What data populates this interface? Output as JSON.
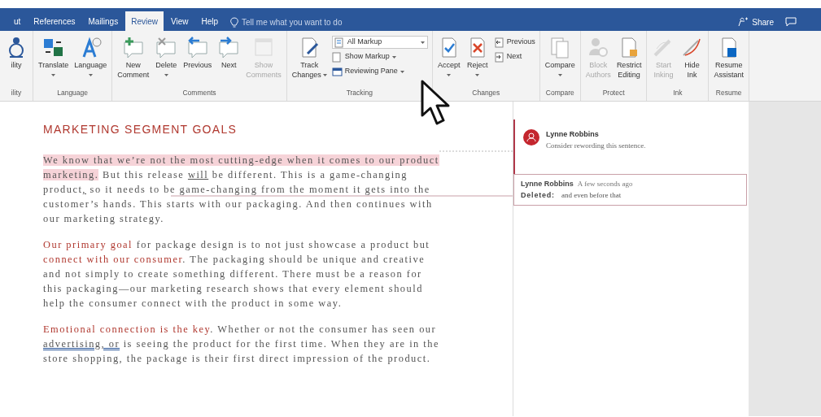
{
  "tabs": [
    {
      "label": "ut",
      "selected": false
    },
    {
      "label": "References",
      "selected": false
    },
    {
      "label": "Mailings",
      "selected": false
    },
    {
      "label": "Review",
      "selected": true
    },
    {
      "label": "View",
      "selected": false
    },
    {
      "label": "Help",
      "selected": false
    }
  ],
  "tell_me": {
    "placeholder": "Tell me what you want to do"
  },
  "share": {
    "label": "Share"
  },
  "ribbon": {
    "groups": [
      {
        "label": "ility",
        "items": [
          {
            "kind": "large",
            "lines": [
              "ility"
            ],
            "disabled": false,
            "dropdown": false
          }
        ]
      },
      {
        "label": "Language",
        "items": [
          {
            "kind": "large",
            "lines": [
              "Translate"
            ],
            "disabled": false,
            "dropdown": true
          },
          {
            "kind": "large",
            "lines": [
              "Language"
            ],
            "disabled": false,
            "dropdown": true
          }
        ]
      },
      {
        "label": "Comments",
        "items": [
          {
            "kind": "large",
            "lines": [
              "New",
              "Comment"
            ],
            "disabled": false,
            "dropdown": false
          },
          {
            "kind": "large",
            "lines": [
              "Delete"
            ],
            "disabled": false,
            "dropdown": true
          },
          {
            "kind": "large",
            "lines": [
              "Previous"
            ],
            "disabled": false,
            "dropdown": false
          },
          {
            "kind": "large",
            "lines": [
              "Next"
            ],
            "disabled": false,
            "dropdown": false
          },
          {
            "kind": "large",
            "lines": [
              "Show",
              "Comments"
            ],
            "disabled": true,
            "dropdown": false
          }
        ]
      },
      {
        "label": "Tracking",
        "items": [
          {
            "kind": "large",
            "lines": [
              "Track",
              "Changes"
            ],
            "disabled": false,
            "dropdown": true
          },
          {
            "kind": "stack",
            "items": [
              {
                "kind": "combo",
                "label": "All Markup",
                "dropdown": true
              },
              {
                "kind": "small",
                "label": "Show Markup",
                "dropdown": true
              },
              {
                "kind": "small",
                "label": "Reviewing Pane",
                "dropdown": true
              }
            ]
          }
        ]
      },
      {
        "label": "Changes",
        "items": [
          {
            "kind": "large",
            "lines": [
              "Accept"
            ],
            "disabled": false,
            "dropdown": true
          },
          {
            "kind": "large",
            "lines": [
              "Reject"
            ],
            "disabled": false,
            "dropdown": true
          },
          {
            "kind": "stack",
            "items": [
              {
                "kind": "small",
                "label": "Previous",
                "dropdown": false
              },
              {
                "kind": "small",
                "label": "Next",
                "dropdown": false
              }
            ]
          }
        ]
      },
      {
        "label": "Compare",
        "items": [
          {
            "kind": "large",
            "lines": [
              "Compare"
            ],
            "disabled": false,
            "dropdown": true
          }
        ]
      },
      {
        "label": "Protect",
        "items": [
          {
            "kind": "large",
            "lines": [
              "Block",
              "Authors"
            ],
            "disabled": true,
            "dropdown": false
          },
          {
            "kind": "large",
            "lines": [
              "Restrict",
              "Editing"
            ],
            "disabled": false,
            "dropdown": false
          }
        ]
      },
      {
        "label": "Ink",
        "items": [
          {
            "kind": "large",
            "lines": [
              "Start",
              "Inking"
            ],
            "disabled": true,
            "dropdown": false
          },
          {
            "kind": "large",
            "lines": [
              "Hide",
              "Ink"
            ],
            "disabled": false,
            "dropdown": false
          }
        ]
      },
      {
        "label": "Resume",
        "items": [
          {
            "kind": "large",
            "lines": [
              "Resume",
              "Assistant"
            ],
            "disabled": false,
            "dropdown": false
          }
        ]
      }
    ]
  },
  "document": {
    "heading": "MARKETING SEGMENT GOALS",
    "paragraphs": [
      {
        "runs": [
          {
            "kind": "highlight",
            "text": "We know that we’re not the most cutting-edge when it comes to our product marketing."
          },
          {
            "kind": "plain",
            "text": " But this release "
          },
          {
            "kind": "underline",
            "text": "will"
          },
          {
            "kind": "plain",
            "text": " be different. This is a game-changing product"
          },
          {
            "kind": "underline",
            "text": ","
          },
          {
            "kind": "plain",
            "text": " so it needs to be game-changing from the moment it gets into the customer’s hands. This starts with our packaging. And then continues with our marketing strategy."
          }
        ]
      },
      {
        "runs": [
          {
            "kind": "red",
            "text": "Our primary goal"
          },
          {
            "kind": "plain",
            "text": " for package design is to not just showcase a product but "
          },
          {
            "kind": "red",
            "text": "connect with our consumer"
          },
          {
            "kind": "plain",
            "text": ". The packaging should be unique and creative and not simply to create something different. There must be a reason for this packaging—our marketing research shows that every element should help the consumer connect with the product in some way."
          }
        ]
      },
      {
        "runs": [
          {
            "kind": "red",
            "text": "Emotional connection is the key"
          },
          {
            "kind": "plain",
            "text": ". Whether or not the consumer has seen our "
          },
          {
            "kind": "grammar",
            "text": "advertising, or"
          },
          {
            "kind": "plain",
            "text": " is seeing the product for the first time. When they are in the store shopping, the package is their first direct impression of the product."
          }
        ]
      }
    ]
  },
  "markup": {
    "comments": [
      {
        "author": "Lynne Robbins",
        "text": "Consider rewording this sentence."
      }
    ],
    "revisions": [
      {
        "author": "Lynne Robbins",
        "time": "A few seconds ago",
        "label": "Deleted:",
        "text": "and even before that"
      }
    ]
  }
}
